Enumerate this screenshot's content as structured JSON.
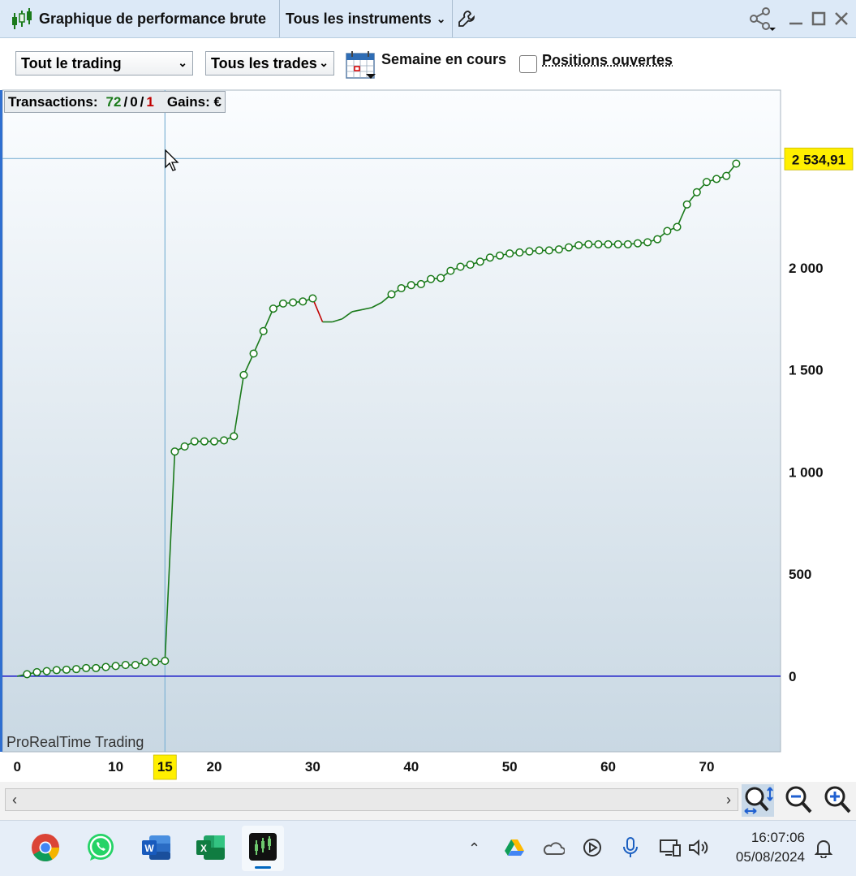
{
  "window": {
    "title": "Graphique de performance brute",
    "instrument_selector": "Tous les instruments"
  },
  "toolbar": {
    "trading_filter": "Tout le trading",
    "trades_filter": "Tous les trades",
    "period_label": "Semaine en cours",
    "open_positions_label": "Positions ouvertes",
    "open_positions_checked": false
  },
  "info": {
    "transactions_label": "Transactions:",
    "wins": "72",
    "neutral": "0",
    "losses": "1",
    "gains_label": "Gains: €",
    "separator": "/"
  },
  "chart_data": {
    "type": "line",
    "x": [
      0,
      1,
      2,
      3,
      4,
      5,
      6,
      7,
      8,
      9,
      10,
      11,
      12,
      13,
      14,
      15,
      16,
      17,
      18,
      19,
      20,
      21,
      22,
      23,
      24,
      25,
      26,
      27,
      28,
      29,
      30,
      31,
      32,
      33,
      34,
      35,
      36,
      37,
      38,
      39,
      40,
      41,
      42,
      43,
      44,
      45,
      46,
      47,
      48,
      49,
      50,
      51,
      52,
      53,
      54,
      55,
      56,
      57,
      58,
      59,
      60,
      61,
      62,
      63,
      64,
      65,
      66,
      67,
      68,
      69,
      70,
      71,
      72,
      73
    ],
    "y": [
      0,
      10,
      20,
      25,
      30,
      32,
      35,
      40,
      40,
      45,
      50,
      55,
      55,
      70,
      70,
      75,
      1100,
      1125,
      1150,
      1150,
      1150,
      1155,
      1175,
      1475,
      1580,
      1690,
      1800,
      1825,
      1830,
      1835,
      1850,
      1735,
      1735,
      1750,
      1785,
      1795,
      1805,
      1830,
      1870,
      1900,
      1915,
      1920,
      1945,
      1950,
      1985,
      2005,
      2015,
      2030,
      2050,
      2060,
      2070,
      2075,
      2080,
      2085,
      2085,
      2090,
      2100,
      2110,
      2115,
      2115,
      2115,
      2115,
      2115,
      2120,
      2125,
      2140,
      2180,
      2200,
      2310,
      2370,
      2420,
      2435,
      2450,
      2510
    ],
    "markers": [
      1,
      2,
      3,
      4,
      5,
      6,
      7,
      8,
      9,
      10,
      11,
      12,
      13,
      14,
      15,
      16,
      17,
      18,
      19,
      20,
      21,
      22,
      23,
      24,
      25,
      26,
      27,
      28,
      29,
      30,
      38,
      39,
      40,
      41,
      42,
      43,
      44,
      45,
      46,
      47,
      48,
      49,
      50,
      51,
      52,
      53,
      54,
      55,
      56,
      57,
      58,
      59,
      60,
      61,
      62,
      63,
      64,
      65,
      66,
      67,
      68,
      69,
      70,
      71,
      72,
      73
    ],
    "loss_segment": [
      30,
      31
    ],
    "xlim": [
      -1.5,
      77.5
    ],
    "ylim": [
      -370,
      2870
    ],
    "xticks": [
      0,
      10,
      15,
      20,
      30,
      40,
      50,
      60,
      70
    ],
    "xtick_labels": [
      "0",
      "10",
      "15",
      "20",
      "30",
      "40",
      "50",
      "60",
      "70"
    ],
    "yticks": [
      0,
      500,
      1000,
      1500,
      2000
    ],
    "ytick_labels": [
      "0",
      "500",
      "1 000",
      "1 500",
      "2 000"
    ],
    "cursor_x": 15,
    "cursor_y": 2534.91,
    "cursor_label": "2 534,91",
    "watermark": "ProRealTime Trading",
    "colors": {
      "line": "#1a7a1a",
      "loss_line": "#c00000",
      "zero_line": "#1a1ac8",
      "crosshair": "#7fb3d5",
      "highlight": "#ffef00"
    }
  },
  "taskbar": {
    "time": "16:07:06",
    "date": "05/08/2024"
  }
}
